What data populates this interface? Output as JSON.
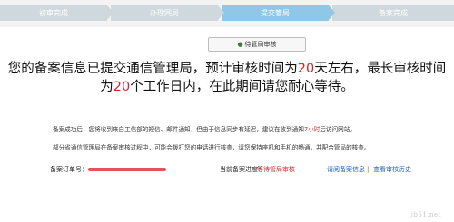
{
  "steps": [
    {
      "label": "初审完成"
    },
    {
      "label": "办理网局"
    },
    {
      "label": "提交管局"
    },
    {
      "label": "备案完成"
    }
  ],
  "pending_button": {
    "icon": "clock-icon",
    "label": "待管局审核"
  },
  "headline": {
    "part1": "您的备案信息已提交通信管理局，预计审核时间为",
    "days": "20",
    "part2": "天左右，最长审核时间为",
    "workdays": "20",
    "part3": "个工作日内，在此期间请您耐心等待。"
  },
  "notes": {
    "line1_a": "备案成功后，您将收到来自工信部的短信、邮件通知，但由于信息同步有延迟，建议在收到通知",
    "line1_hl": "7小时",
    "line1_b": "后访问网站。",
    "line2": "部分省通信管理局在备案审核过程中，可能会拨打您的电话进行核查，请您保持座机和手机的畅通，并配合管局的核查。"
  },
  "order": {
    "label": "备案订单号："
  },
  "progress": {
    "label": "当前备案进度：",
    "value": "等待管局审核"
  },
  "links": {
    "details": "请阅备案信息",
    "separator": "|",
    "history": "查看审核历史"
  },
  "colors": {
    "accent_red": "#d6262b",
    "link_blue": "#1f5fbf",
    "active_step": "#8fc7e6",
    "inactive_step": "#cfd8dd"
  }
}
